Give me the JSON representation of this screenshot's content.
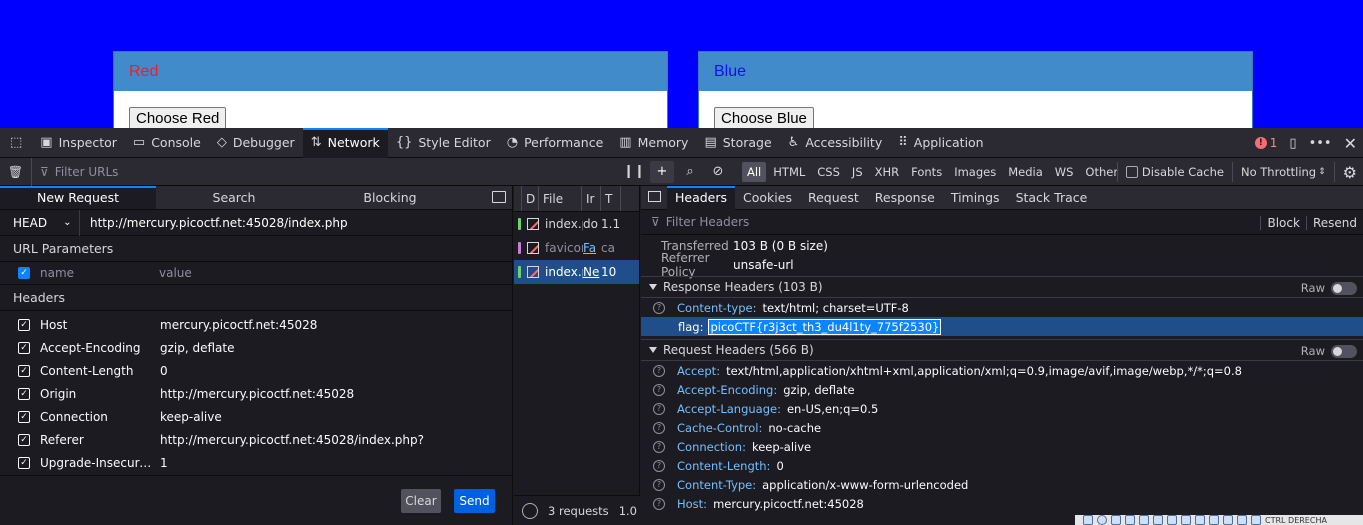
{
  "page": {
    "left_card": {
      "title": "Red",
      "button": "Choose Red"
    },
    "right_card": {
      "title": "Blue",
      "button": "Choose Blue"
    }
  },
  "toolbox": {
    "tabs": [
      "Inspector",
      "Console",
      "Debugger",
      "Network",
      "Style Editor",
      "Performance",
      "Memory",
      "Storage",
      "Accessibility",
      "Application"
    ],
    "active_tab": "Network",
    "error_count": "1"
  },
  "filterbar": {
    "placeholder": "Filter URLs",
    "types": [
      "All",
      "HTML",
      "CSS",
      "JS",
      "XHR",
      "Fonts",
      "Images",
      "Media",
      "WS",
      "Other"
    ],
    "active_type": "All",
    "disable_cache": "Disable Cache",
    "throttling": "No Throttling"
  },
  "new_request": {
    "tabs": [
      "New Request",
      "Search",
      "Blocking"
    ],
    "method": "HEAD",
    "url": "http://mercury.picoctf.net:45028/index.php",
    "url_params_title": "URL Parameters",
    "param_placeholder_name": "name",
    "param_placeholder_value": "value",
    "headers_title": "Headers",
    "headers": [
      {
        "name": "Host",
        "value": "mercury.picoctf.net:45028"
      },
      {
        "name": "Accept-Encoding",
        "value": "gzip, deflate"
      },
      {
        "name": "Content-Length",
        "value": "0"
      },
      {
        "name": "Origin",
        "value": "http://mercury.picoctf.net:45028"
      },
      {
        "name": "Connection",
        "value": "keep-alive"
      },
      {
        "name": "Referer",
        "value": "http://mercury.picoctf.net:45028/index.php?"
      },
      {
        "name": "Upgrade-Insecure-…",
        "value": "1"
      }
    ],
    "clear_label": "Clear",
    "send_label": "Send"
  },
  "request_list": {
    "columns": [
      "D",
      "File",
      "Ir",
      "T"
    ],
    "rows": [
      {
        "file": "index.pl",
        "initiator": "do",
        "type": "1.1",
        "marker": "#6ed36e",
        "dim": false,
        "link": false
      },
      {
        "file": "favicon.",
        "initiator": "Fa",
        "type": "ca",
        "marker": "#c67ed6",
        "dim": true,
        "link": true
      },
      {
        "file": "index.pl",
        "initiator": "Ne",
        "type": "10",
        "marker": "#6ed36e",
        "dim": false,
        "link": true
      }
    ],
    "footer": "3 requests",
    "footer_extra": "1.0"
  },
  "details": {
    "tabs": [
      "Headers",
      "Cookies",
      "Request",
      "Response",
      "Timings",
      "Stack Trace"
    ],
    "filter_placeholder": "Filter Headers",
    "block_label": "Block",
    "resend_label": "Resend",
    "summary": [
      {
        "key": "Transferred",
        "value": "103 B (0 B size)"
      },
      {
        "key": "Referrer Policy",
        "value": "unsafe-url"
      }
    ],
    "response_group": "Response Headers (103 B)",
    "raw_label": "Raw",
    "response_headers": [
      {
        "key": "Content-type:",
        "value": "text/html; charset=UTF-8"
      },
      {
        "key": "flag:",
        "value": "picoCTF{r3j3ct_th3_du4l1ty_775f2530}"
      }
    ],
    "request_group": "Request Headers (566 B)",
    "request_headers": [
      {
        "key": "Accept:",
        "value": "text/html,application/xhtml+xml,application/xml;q=0.9,image/avif,image/webp,*/*;q=0.8"
      },
      {
        "key": "Accept-Encoding:",
        "value": "gzip, deflate"
      },
      {
        "key": "Accept-Language:",
        "value": "en-US,en;q=0.5"
      },
      {
        "key": "Cache-Control:",
        "value": "no-cache"
      },
      {
        "key": "Connection:",
        "value": "keep-alive"
      },
      {
        "key": "Content-Length:",
        "value": "0"
      },
      {
        "key": "Content-Type:",
        "value": "application/x-www-form-urlencoded"
      },
      {
        "key": "Host:",
        "value": "mercury.picoctf.net:45028"
      }
    ]
  },
  "taskbar": {
    "label": "CTRL DERECHA"
  },
  "colors": {
    "accent": "#0a84ff",
    "page_bg": "#0000ff",
    "card_header": "#428bca",
    "selected_row": "#204e8a"
  }
}
